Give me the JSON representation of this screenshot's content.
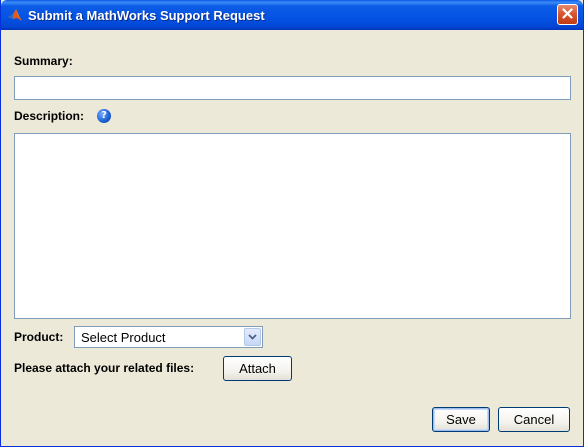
{
  "window": {
    "title": "Submit a MathWorks Support Request",
    "close_glyph": "✕"
  },
  "form": {
    "summary_label": "Summary:",
    "summary_value": "",
    "description_label": "Description:",
    "description_value": "",
    "help_glyph": "?",
    "product_label": "Product:",
    "product_selected": "Select Product",
    "attach_label": "Please attach your related files:",
    "attach_button": "Attach"
  },
  "footer": {
    "save_button": "Save",
    "cancel_button": "Cancel"
  },
  "icons": {
    "app_icon": "matlab-logo-icon",
    "help": "help-icon",
    "dropdown": "chevron-down-icon",
    "close": "close-icon"
  },
  "colors": {
    "titlebar": "#0453e3",
    "dialog_bg": "#ece9d8",
    "input_border": "#7f9db9",
    "close_button": "#d8522c"
  }
}
